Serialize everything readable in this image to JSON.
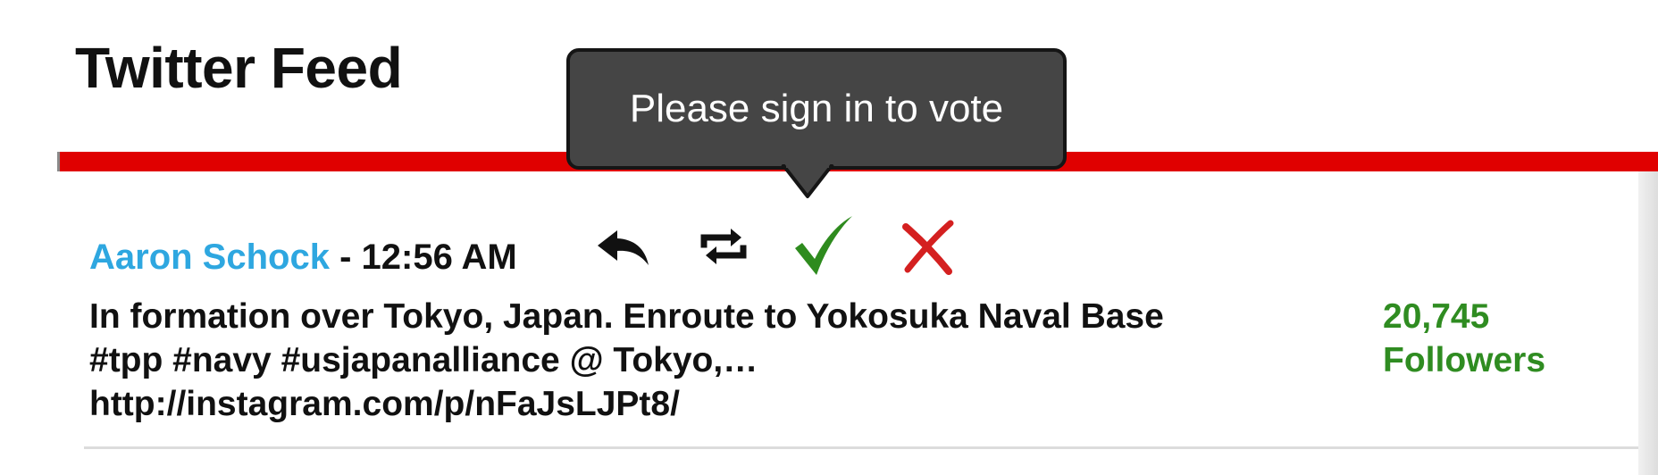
{
  "widget": {
    "title": "Twitter Feed"
  },
  "tooltip": {
    "text": "Please sign in to vote"
  },
  "tweet": {
    "author": "Aaron Schock",
    "separator": " - ",
    "time": "12:56 AM",
    "body_lines": [
      "In formation over Tokyo, Japan. Enroute to Yokosuka Naval Base",
      "#tpp #navy #usjapanalliance @ Tokyo,…",
      "http://instagram.com/p/nFaJsLJPt8/"
    ],
    "followers_count": "20,745",
    "followers_label": "Followers"
  },
  "actions": [
    {
      "name": "reply",
      "icon": "reply-icon"
    },
    {
      "name": "retweet",
      "icon": "retweet-icon"
    },
    {
      "name": "upvote",
      "icon": "checkmark-icon"
    },
    {
      "name": "downvote",
      "icon": "x-icon"
    }
  ],
  "colors": {
    "accent_bar": "#e00000",
    "author_link": "#2ea7e0",
    "followers": "#2f8c21",
    "upvote": "#2e8b1e",
    "downvote": "#d42020",
    "tooltip_bg": "#454545"
  }
}
